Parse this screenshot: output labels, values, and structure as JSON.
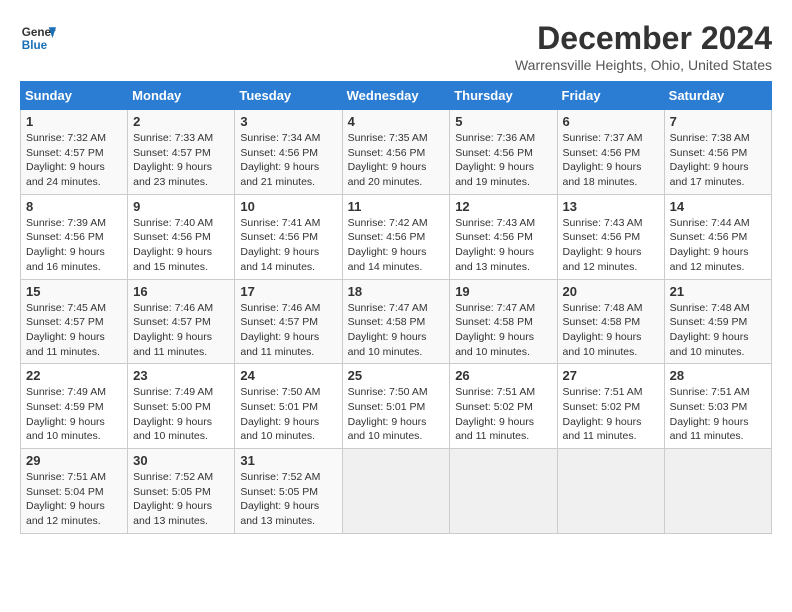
{
  "header": {
    "logo_line1": "General",
    "logo_line2": "Blue",
    "title": "December 2024",
    "location": "Warrensville Heights, Ohio, United States"
  },
  "weekdays": [
    "Sunday",
    "Monday",
    "Tuesday",
    "Wednesday",
    "Thursday",
    "Friday",
    "Saturday"
  ],
  "weeks": [
    [
      {
        "day": "1",
        "sunrise": "7:32 AM",
        "sunset": "4:57 PM",
        "daylight": "9 hours and 24 minutes."
      },
      {
        "day": "2",
        "sunrise": "7:33 AM",
        "sunset": "4:57 PM",
        "daylight": "9 hours and 23 minutes."
      },
      {
        "day": "3",
        "sunrise": "7:34 AM",
        "sunset": "4:56 PM",
        "daylight": "9 hours and 21 minutes."
      },
      {
        "day": "4",
        "sunrise": "7:35 AM",
        "sunset": "4:56 PM",
        "daylight": "9 hours and 20 minutes."
      },
      {
        "day": "5",
        "sunrise": "7:36 AM",
        "sunset": "4:56 PM",
        "daylight": "9 hours and 19 minutes."
      },
      {
        "day": "6",
        "sunrise": "7:37 AM",
        "sunset": "4:56 PM",
        "daylight": "9 hours and 18 minutes."
      },
      {
        "day": "7",
        "sunrise": "7:38 AM",
        "sunset": "4:56 PM",
        "daylight": "9 hours and 17 minutes."
      }
    ],
    [
      {
        "day": "8",
        "sunrise": "7:39 AM",
        "sunset": "4:56 PM",
        "daylight": "9 hours and 16 minutes."
      },
      {
        "day": "9",
        "sunrise": "7:40 AM",
        "sunset": "4:56 PM",
        "daylight": "9 hours and 15 minutes."
      },
      {
        "day": "10",
        "sunrise": "7:41 AM",
        "sunset": "4:56 PM",
        "daylight": "9 hours and 14 minutes."
      },
      {
        "day": "11",
        "sunrise": "7:42 AM",
        "sunset": "4:56 PM",
        "daylight": "9 hours and 14 minutes."
      },
      {
        "day": "12",
        "sunrise": "7:43 AM",
        "sunset": "4:56 PM",
        "daylight": "9 hours and 13 minutes."
      },
      {
        "day": "13",
        "sunrise": "7:43 AM",
        "sunset": "4:56 PM",
        "daylight": "9 hours and 12 minutes."
      },
      {
        "day": "14",
        "sunrise": "7:44 AM",
        "sunset": "4:56 PM",
        "daylight": "9 hours and 12 minutes."
      }
    ],
    [
      {
        "day": "15",
        "sunrise": "7:45 AM",
        "sunset": "4:57 PM",
        "daylight": "9 hours and 11 minutes."
      },
      {
        "day": "16",
        "sunrise": "7:46 AM",
        "sunset": "4:57 PM",
        "daylight": "9 hours and 11 minutes."
      },
      {
        "day": "17",
        "sunrise": "7:46 AM",
        "sunset": "4:57 PM",
        "daylight": "9 hours and 11 minutes."
      },
      {
        "day": "18",
        "sunrise": "7:47 AM",
        "sunset": "4:58 PM",
        "daylight": "9 hours and 10 minutes."
      },
      {
        "day": "19",
        "sunrise": "7:47 AM",
        "sunset": "4:58 PM",
        "daylight": "9 hours and 10 minutes."
      },
      {
        "day": "20",
        "sunrise": "7:48 AM",
        "sunset": "4:58 PM",
        "daylight": "9 hours and 10 minutes."
      },
      {
        "day": "21",
        "sunrise": "7:48 AM",
        "sunset": "4:59 PM",
        "daylight": "9 hours and 10 minutes."
      }
    ],
    [
      {
        "day": "22",
        "sunrise": "7:49 AM",
        "sunset": "4:59 PM",
        "daylight": "9 hours and 10 minutes."
      },
      {
        "day": "23",
        "sunrise": "7:49 AM",
        "sunset": "5:00 PM",
        "daylight": "9 hours and 10 minutes."
      },
      {
        "day": "24",
        "sunrise": "7:50 AM",
        "sunset": "5:01 PM",
        "daylight": "9 hours and 10 minutes."
      },
      {
        "day": "25",
        "sunrise": "7:50 AM",
        "sunset": "5:01 PM",
        "daylight": "9 hours and 10 minutes."
      },
      {
        "day": "26",
        "sunrise": "7:51 AM",
        "sunset": "5:02 PM",
        "daylight": "9 hours and 11 minutes."
      },
      {
        "day": "27",
        "sunrise": "7:51 AM",
        "sunset": "5:02 PM",
        "daylight": "9 hours and 11 minutes."
      },
      {
        "day": "28",
        "sunrise": "7:51 AM",
        "sunset": "5:03 PM",
        "daylight": "9 hours and 11 minutes."
      }
    ],
    [
      {
        "day": "29",
        "sunrise": "7:51 AM",
        "sunset": "5:04 PM",
        "daylight": "9 hours and 12 minutes."
      },
      {
        "day": "30",
        "sunrise": "7:52 AM",
        "sunset": "5:05 PM",
        "daylight": "9 hours and 13 minutes."
      },
      {
        "day": "31",
        "sunrise": "7:52 AM",
        "sunset": "5:05 PM",
        "daylight": "9 hours and 13 minutes."
      },
      null,
      null,
      null,
      null
    ]
  ],
  "labels": {
    "sunrise": "Sunrise:",
    "sunset": "Sunset:",
    "daylight": "Daylight:"
  }
}
